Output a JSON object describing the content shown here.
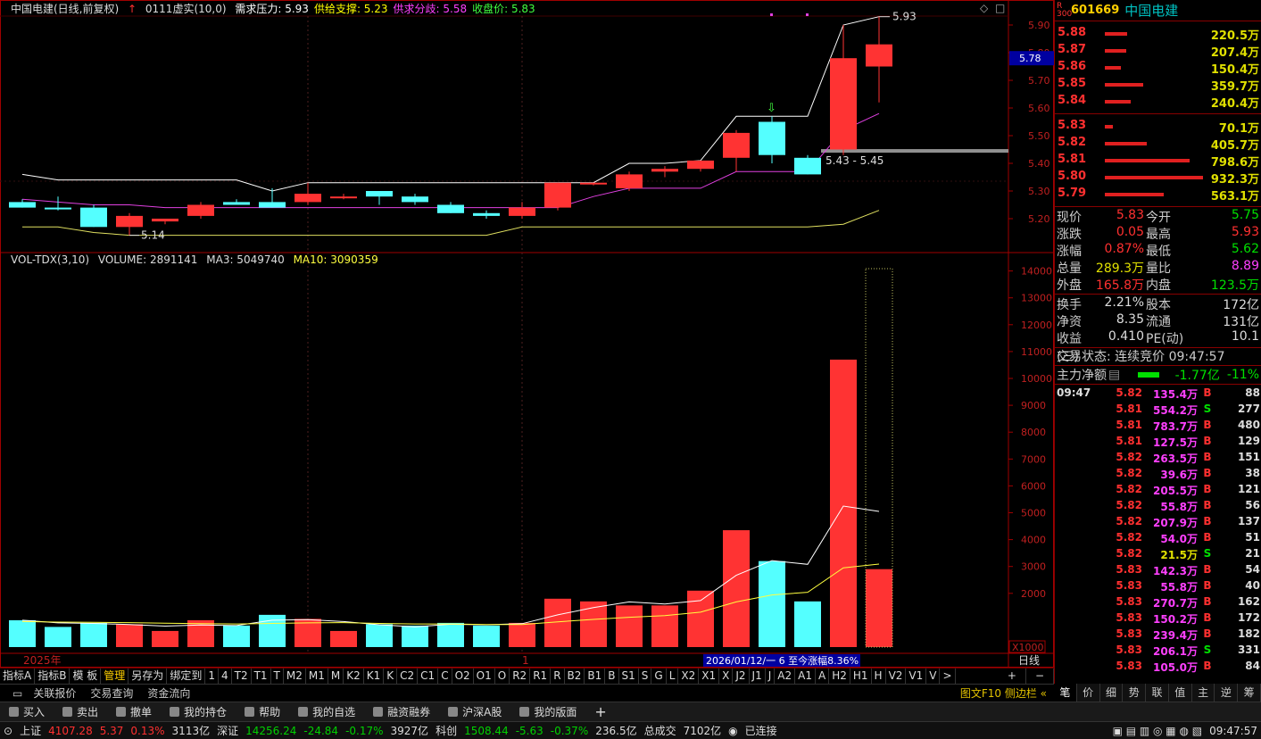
{
  "header": {
    "title": "中国电建(日线,前复权)",
    "indicator": "0111虚实(10,0)",
    "items": [
      {
        "label": "需求压力:",
        "value": "5.93",
        "color": "#ffffff"
      },
      {
        "label": "供给支撑:",
        "value": "5.23",
        "color": "#ffff00"
      },
      {
        "label": "供求分歧:",
        "value": "5.58",
        "color": "#ff40ff"
      },
      {
        "label": "收盘价:",
        "value": "5.83",
        "color": "#40ff40"
      }
    ]
  },
  "volume_header": {
    "name": "VOL-TDX(3,10)",
    "volume": "VOLUME: 2891141",
    "ma3": "MA3: 5049740",
    "ma10": "MA10: 3090359"
  },
  "price_axis": [
    "5.90",
    "5.80",
    "5.70",
    "5.60",
    "5.50",
    "5.40",
    "5.30",
    "5.20"
  ],
  "current_price_tag": "5.78",
  "volume_axis": [
    "14000",
    "13000",
    "12000",
    "11000",
    "10000",
    "9000",
    "8000",
    "7000",
    "6000",
    "5000",
    "4000",
    "3000",
    "2000"
  ],
  "volume_unit": "X1000",
  "annotations": {
    "high_label": "5.93",
    "low_label": "5.14",
    "gap_label": "5.43 - 5.45",
    "year_label": "2025年",
    "month_label": "1",
    "range_info": "2026/01/12/一 6 至今涨幅8.36%",
    "period": "日线"
  },
  "chart_data": {
    "type": "candlestick",
    "candles": [
      {
        "o": 5.26,
        "h": 5.27,
        "l": 5.24,
        "c": 5.24,
        "up": false
      },
      {
        "o": 5.24,
        "h": 5.28,
        "l": 5.23,
        "c": 5.24,
        "up": false
      },
      {
        "o": 5.24,
        "h": 5.25,
        "l": 5.17,
        "c": 5.17,
        "up": false
      },
      {
        "o": 5.17,
        "h": 5.22,
        "l": 5.14,
        "c": 5.21,
        "up": true
      },
      {
        "o": 5.19,
        "h": 5.2,
        "l": 5.18,
        "c": 5.2,
        "up": true
      },
      {
        "o": 5.21,
        "h": 5.26,
        "l": 5.2,
        "c": 5.25,
        "up": true
      },
      {
        "o": 5.26,
        "h": 5.27,
        "l": 5.25,
        "c": 5.25,
        "up": false
      },
      {
        "o": 5.26,
        "h": 5.31,
        "l": 5.24,
        "c": 5.24,
        "up": false
      },
      {
        "o": 5.26,
        "h": 5.33,
        "l": 5.25,
        "c": 5.29,
        "up": true
      },
      {
        "o": 5.28,
        "h": 5.29,
        "l": 5.27,
        "c": 5.28,
        "up": true
      },
      {
        "o": 5.3,
        "h": 5.3,
        "l": 5.25,
        "c": 5.28,
        "up": false
      },
      {
        "o": 5.28,
        "h": 5.29,
        "l": 5.25,
        "c": 5.26,
        "up": false
      },
      {
        "o": 5.25,
        "h": 5.26,
        "l": 5.22,
        "c": 5.22,
        "up": false
      },
      {
        "o": 5.22,
        "h": 5.23,
        "l": 5.2,
        "c": 5.21,
        "up": false
      },
      {
        "o": 5.21,
        "h": 5.26,
        "l": 5.2,
        "c": 5.24,
        "up": true
      },
      {
        "o": 5.24,
        "h": 5.33,
        "l": 5.23,
        "c": 5.33,
        "up": true
      },
      {
        "o": 5.33,
        "h": 5.33,
        "l": 5.32,
        "c": 5.33,
        "up": true
      },
      {
        "o": 5.31,
        "h": 5.37,
        "l": 5.3,
        "c": 5.36,
        "up": true
      },
      {
        "o": 5.37,
        "h": 5.39,
        "l": 5.35,
        "c": 5.38,
        "up": true
      },
      {
        "o": 5.38,
        "h": 5.41,
        "l": 5.37,
        "c": 5.41,
        "up": true
      },
      {
        "o": 5.42,
        "h": 5.52,
        "l": 5.37,
        "c": 5.51,
        "up": true
      },
      {
        "o": 5.55,
        "h": 5.57,
        "l": 5.4,
        "c": 5.43,
        "up": false
      },
      {
        "o": 5.42,
        "h": 5.43,
        "l": 5.36,
        "c": 5.36,
        "up": false
      },
      {
        "o": 5.45,
        "h": 5.9,
        "l": 5.43,
        "c": 5.78,
        "up": true
      },
      {
        "o": 5.75,
        "h": 5.93,
        "l": 5.62,
        "c": 5.83,
        "up": true
      }
    ],
    "volumes": [
      1000,
      750,
      900,
      850,
      600,
      1000,
      800,
      1200,
      1050,
      600,
      850,
      800,
      900,
      800,
      900,
      1800,
      1700,
      1550,
      1550,
      2100,
      4350,
      3200,
      1700,
      10700,
      2900
    ],
    "lines": {
      "demand": [
        5.36,
        5.34,
        5.34,
        5.34,
        5.34,
        5.34,
        5.34,
        5.3,
        5.33,
        5.33,
        5.33,
        5.33,
        5.33,
        5.33,
        5.33,
        5.33,
        5.33,
        5.4,
        5.4,
        5.41,
        5.57,
        5.57,
        5.57,
        5.9,
        5.93
      ],
      "spread": [
        5.27,
        5.26,
        5.25,
        5.25,
        5.24,
        5.24,
        5.24,
        5.24,
        5.24,
        5.24,
        5.24,
        5.24,
        5.24,
        5.24,
        5.24,
        5.24,
        5.28,
        5.31,
        5.31,
        5.31,
        5.37,
        5.37,
        5.37,
        5.52,
        5.58
      ],
      "supply": [
        5.17,
        5.17,
        5.15,
        5.14,
        5.14,
        5.14,
        5.14,
        5.14,
        5.14,
        5.14,
        5.14,
        5.14,
        5.14,
        5.14,
        5.17,
        5.17,
        5.17,
        5.17,
        5.17,
        5.17,
        5.17,
        5.17,
        5.17,
        5.18,
        5.23
      ],
      "ma3": [
        1000,
        900,
        880,
        840,
        780,
        820,
        800,
        1000,
        1020,
        950,
        830,
        750,
        850,
        830,
        870,
        1200,
        1470,
        1680,
        1600,
        1730,
        2670,
        3220,
        3080,
        5250,
        5050
      ],
      "ma10": [
        950,
        930,
        920,
        910,
        890,
        870,
        860,
        880,
        900,
        910,
        880,
        860,
        860,
        840,
        840,
        940,
        1030,
        1110,
        1170,
        1300,
        1680,
        1940,
        2040,
        2950,
        3090
      ]
    }
  },
  "tabs": [
    "指标A",
    "指标B",
    "模 板",
    "管理",
    "另存为",
    "绑定到",
    "1",
    "4",
    "T2",
    "T1",
    "T",
    "M2",
    "M1",
    "M",
    "K2",
    "K1",
    "K",
    "C2",
    "C1",
    "C",
    "O2",
    "O1",
    "O",
    "R2",
    "R1",
    "R",
    "B2",
    "B1",
    "B",
    "S1",
    "S",
    "G",
    "L",
    "X2",
    "X1",
    "X",
    "J2",
    "J1",
    "J",
    "A2",
    "A1",
    "A",
    "H2",
    "H1",
    "H",
    "V2",
    "V1",
    "V",
    ">"
  ],
  "subtabs": [
    "关联报价",
    "交易查询",
    "资金流向"
  ],
  "subtabs_right": "图文F10 侧边栏 «",
  "right_tabs": [
    "笔",
    "价",
    "细",
    "势",
    "联",
    "值",
    "主",
    "逆",
    "筹"
  ],
  "toolbar": [
    "买入",
    "卖出",
    "撤单",
    "我的持仓",
    "帮助",
    "我的自选",
    "融资融券",
    "沪深A股",
    "我的版面"
  ],
  "status": {
    "sh_label": "上证",
    "sh_val": "4107.28",
    "sh_chg": "5.37",
    "sh_pct": "0.13%",
    "sh_amt": "3113亿",
    "sz_label": "深证",
    "sz_val": "14256.24",
    "sz_chg": "-24.84",
    "sz_pct": "-0.17%",
    "sz_amt": "3927亿",
    "kc_label": "科创",
    "kc_val": "1508.44",
    "kc_chg": "-5.63",
    "kc_pct": "-0.37%",
    "kc_amt": "236.5亿",
    "total_label": "总成交",
    "total_amt": "7102亿",
    "conn": "已连接",
    "time": "09:47:57"
  },
  "stock": {
    "badge": "R 300",
    "code": "601669",
    "name": "中国电建"
  },
  "asks": [
    {
      "p": "5.88",
      "v": "220.5万",
      "w": 0.23
    },
    {
      "p": "5.87",
      "v": "207.4万",
      "w": 0.22
    },
    {
      "p": "5.86",
      "v": "150.4万",
      "w": 0.16
    },
    {
      "p": "5.85",
      "v": "359.7万",
      "w": 0.39
    },
    {
      "p": "5.84",
      "v": "240.4万",
      "w": 0.26
    }
  ],
  "bids": [
    {
      "p": "5.83",
      "v": "70.1万",
      "w": 0.08
    },
    {
      "p": "5.82",
      "v": "405.7万",
      "w": 0.43
    },
    {
      "p": "5.81",
      "v": "798.6万",
      "w": 0.86
    },
    {
      "p": "5.80",
      "v": "932.3万",
      "w": 1.0
    },
    {
      "p": "5.79",
      "v": "563.1万",
      "w": 0.6
    }
  ],
  "quote": [
    {
      "l1": "现价",
      "v1": "5.83",
      "c1": "#ff3030",
      "l2": "今开",
      "v2": "5.75",
      "c2": "#00e000"
    },
    {
      "l1": "涨跌",
      "v1": "0.05",
      "c1": "#ff3030",
      "l2": "最高",
      "v2": "5.93",
      "c2": "#ff3030"
    },
    {
      "l1": "涨幅",
      "v1": "0.87%",
      "c1": "#ff3030",
      "l2": "最低",
      "v2": "5.62",
      "c2": "#00e000"
    },
    {
      "l1": "总量",
      "v1": "289.3万",
      "c1": "#e0e000",
      "l2": "量比",
      "v2": "8.89",
      "c2": "#ff40ff"
    },
    {
      "l1": "外盘",
      "v1": "165.8万",
      "c1": "#ff3030",
      "l2": "内盘",
      "v2": "123.5万",
      "c2": "#00e000"
    }
  ],
  "quote2": [
    {
      "l1": "换手",
      "v1": "2.21%",
      "c1": "#dddddd",
      "l2": "股本",
      "v2": "172亿",
      "c2": "#dddddd"
    },
    {
      "l1": "净资",
      "v1": "8.35",
      "c1": "#dddddd",
      "l2": "流通",
      "v2": "131亿",
      "c2": "#dddddd"
    },
    {
      "l1": "收益(三)",
      "v1": "0.410",
      "c1": "#dddddd",
      "l2": "PE(动)",
      "v2": "10.1",
      "c2": "#dddddd"
    }
  ],
  "trade_state": "交易状态: 连续竞价 09:47:57",
  "main_flow": {
    "label": "主力净额",
    "val": "-1.77亿",
    "pct": "-11%"
  },
  "ticks": [
    {
      "t": "09:47",
      "p": "5.82",
      "v": "135.4万",
      "vc": "#ff40ff",
      "f": "B",
      "n": "88"
    },
    {
      "t": "",
      "p": "5.81",
      "v": "554.2万",
      "vc": "#ff40ff",
      "f": "S",
      "n": "277"
    },
    {
      "t": "",
      "p": "5.81",
      "v": "783.7万",
      "vc": "#ff40ff",
      "f": "B",
      "n": "480"
    },
    {
      "t": "",
      "p": "5.81",
      "v": "127.5万",
      "vc": "#ff40ff",
      "f": "B",
      "n": "129"
    },
    {
      "t": "",
      "p": "5.82",
      "v": "263.5万",
      "vc": "#ff40ff",
      "f": "B",
      "n": "151"
    },
    {
      "t": "",
      "p": "5.82",
      "v": "39.6万",
      "vc": "#ff40ff",
      "f": "B",
      "n": "38"
    },
    {
      "t": "",
      "p": "5.82",
      "v": "205.5万",
      "vc": "#ff40ff",
      "f": "B",
      "n": "121"
    },
    {
      "t": "",
      "p": "5.82",
      "v": "55.8万",
      "vc": "#ff40ff",
      "f": "B",
      "n": "56"
    },
    {
      "t": "",
      "p": "5.82",
      "v": "207.9万",
      "vc": "#ff40ff",
      "f": "B",
      "n": "137"
    },
    {
      "t": "",
      "p": "5.82",
      "v": "54.0万",
      "vc": "#ff40ff",
      "f": "B",
      "n": "51"
    },
    {
      "t": "",
      "p": "5.82",
      "v": "21.5万",
      "vc": "#e0e000",
      "f": "S",
      "n": "21"
    },
    {
      "t": "",
      "p": "5.83",
      "v": "142.3万",
      "vc": "#ff40ff",
      "f": "B",
      "n": "54"
    },
    {
      "t": "",
      "p": "5.83",
      "v": "55.8万",
      "vc": "#ff40ff",
      "f": "B",
      "n": "40"
    },
    {
      "t": "",
      "p": "5.83",
      "v": "270.7万",
      "vc": "#ff40ff",
      "f": "B",
      "n": "162"
    },
    {
      "t": "",
      "p": "5.83",
      "v": "150.2万",
      "vc": "#ff40ff",
      "f": "B",
      "n": "172"
    },
    {
      "t": "",
      "p": "5.83",
      "v": "239.4万",
      "vc": "#ff40ff",
      "f": "B",
      "n": "182"
    },
    {
      "t": "",
      "p": "5.83",
      "v": "206.1万",
      "vc": "#ff40ff",
      "f": "S",
      "n": "331"
    },
    {
      "t": "",
      "p": "5.83",
      "v": "105.0万",
      "vc": "#ff40ff",
      "f": "B",
      "n": "84"
    }
  ]
}
